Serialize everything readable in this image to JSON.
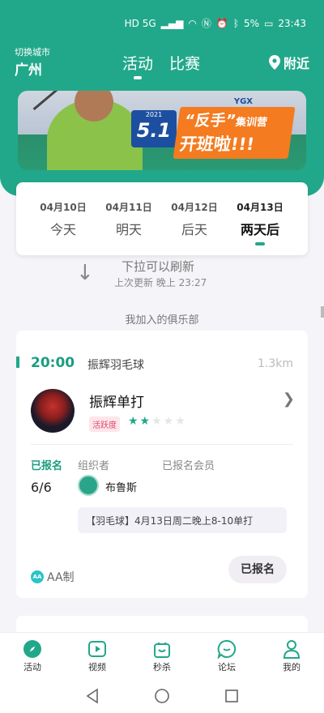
{
  "status_bar": {
    "network": "HD 5G",
    "battery": "5%",
    "time": "23:43"
  },
  "header": {
    "city_switch_label": "切换城市",
    "city": "广州",
    "tabs": [
      {
        "label": "活动",
        "active": true
      },
      {
        "label": "比赛",
        "active": false
      }
    ],
    "nearby_label": "附近"
  },
  "banner": {
    "badge_year": "2021",
    "badge_day": "5.1",
    "promo_line1": "“反手”",
    "promo_line1_suffix": "集训营",
    "promo_line2": "开班啦!!!",
    "logo_text": "YGX"
  },
  "dates": [
    {
      "date": "04月10日",
      "label": "今天",
      "active": false
    },
    {
      "date": "04月11日",
      "label": "明天",
      "active": false
    },
    {
      "date": "04月12日",
      "label": "后天",
      "active": false
    },
    {
      "date": "04月13日",
      "label": "两天后",
      "active": true
    }
  ],
  "refresh": {
    "main": "下拉可以刷新",
    "sub": "上次更新 晚上 23:27"
  },
  "section_label": "我加入的俱乐部",
  "activity": {
    "time": "20:00",
    "venue": "振辉羽毛球",
    "distance": "1.3km",
    "club_name": "振辉单打",
    "tag": "活跃度",
    "stars_on": "★★",
    "stars_off": "★★★",
    "signed_label": "已报名",
    "organizer_label": "组织者",
    "members_label": "已报名会员",
    "count": "6/6",
    "organizer": "布鲁斯",
    "note": "【羽毛球】4月13日周二晚上8-10单打",
    "aa_icon_text": "AA",
    "aa_label": "AA制",
    "button_label": "已报名"
  },
  "bottom_nav": [
    {
      "label": "活动",
      "icon": "compass-icon"
    },
    {
      "label": "视频",
      "icon": "play-icon"
    },
    {
      "label": "秒杀",
      "icon": "bag-icon"
    },
    {
      "label": "论坛",
      "icon": "chat-icon"
    },
    {
      "label": "我的",
      "icon": "user-icon"
    }
  ],
  "colors": {
    "brand": "#21a88a",
    "accent_orange": "#f47b20"
  }
}
